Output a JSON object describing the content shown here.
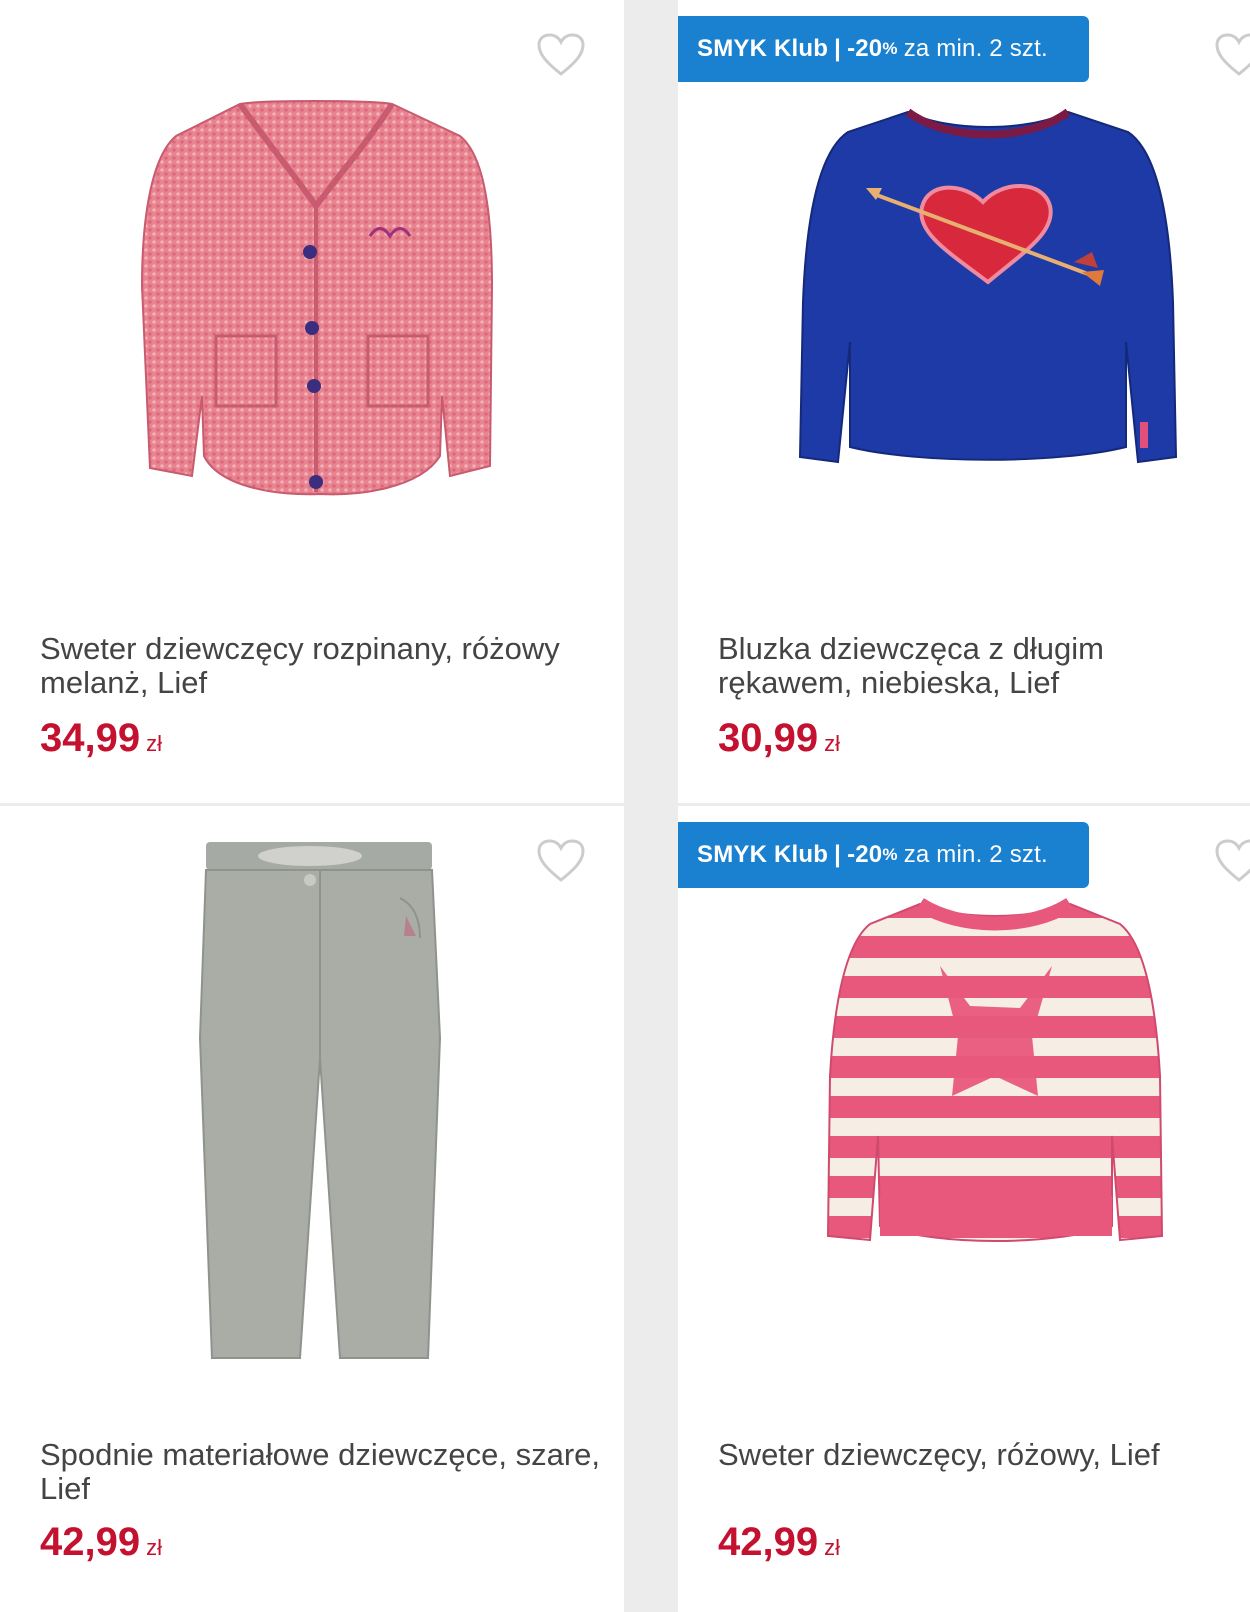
{
  "colors": {
    "price": "#c4112f",
    "badge_bg": "#1a80d0",
    "title_text": "#444444",
    "heart_outline": "#cccccc"
  },
  "products": [
    {
      "title": "Sweter dziewczęcy rozpinany, różowy melanż, Lief",
      "price": "34,99",
      "currency": "zł",
      "badge": null,
      "image": "pink-knit-cardigan",
      "favorite_icon": "heart-outline-icon"
    },
    {
      "title": "Bluzka dziewczęca z długim rękawem, niebieska, Lief",
      "price": "30,99",
      "currency": "zł",
      "badge": {
        "brand": "SMYK Klub",
        "separator": "|",
        "discount": "-20",
        "percent": "%",
        "condition": "za min. 2 szt."
      },
      "image": "blue-sweatshirt-heart",
      "favorite_icon": "heart-outline-icon"
    },
    {
      "title": "Spodnie materiałowe dziewczęce, szare, Lief",
      "price": "42,99",
      "currency": "zł",
      "badge": null,
      "image": "grey-trousers",
      "favorite_icon": "heart-outline-icon"
    },
    {
      "title": "Sweter dziewczęcy, różowy, Lief",
      "price": "42,99",
      "currency": "zł",
      "badge": {
        "brand": "SMYK Klub",
        "separator": "|",
        "discount": "-20",
        "percent": "%",
        "condition": "za min. 2 szt."
      },
      "image": "pink-striped-sweater",
      "favorite_icon": "heart-outline-icon"
    }
  ]
}
